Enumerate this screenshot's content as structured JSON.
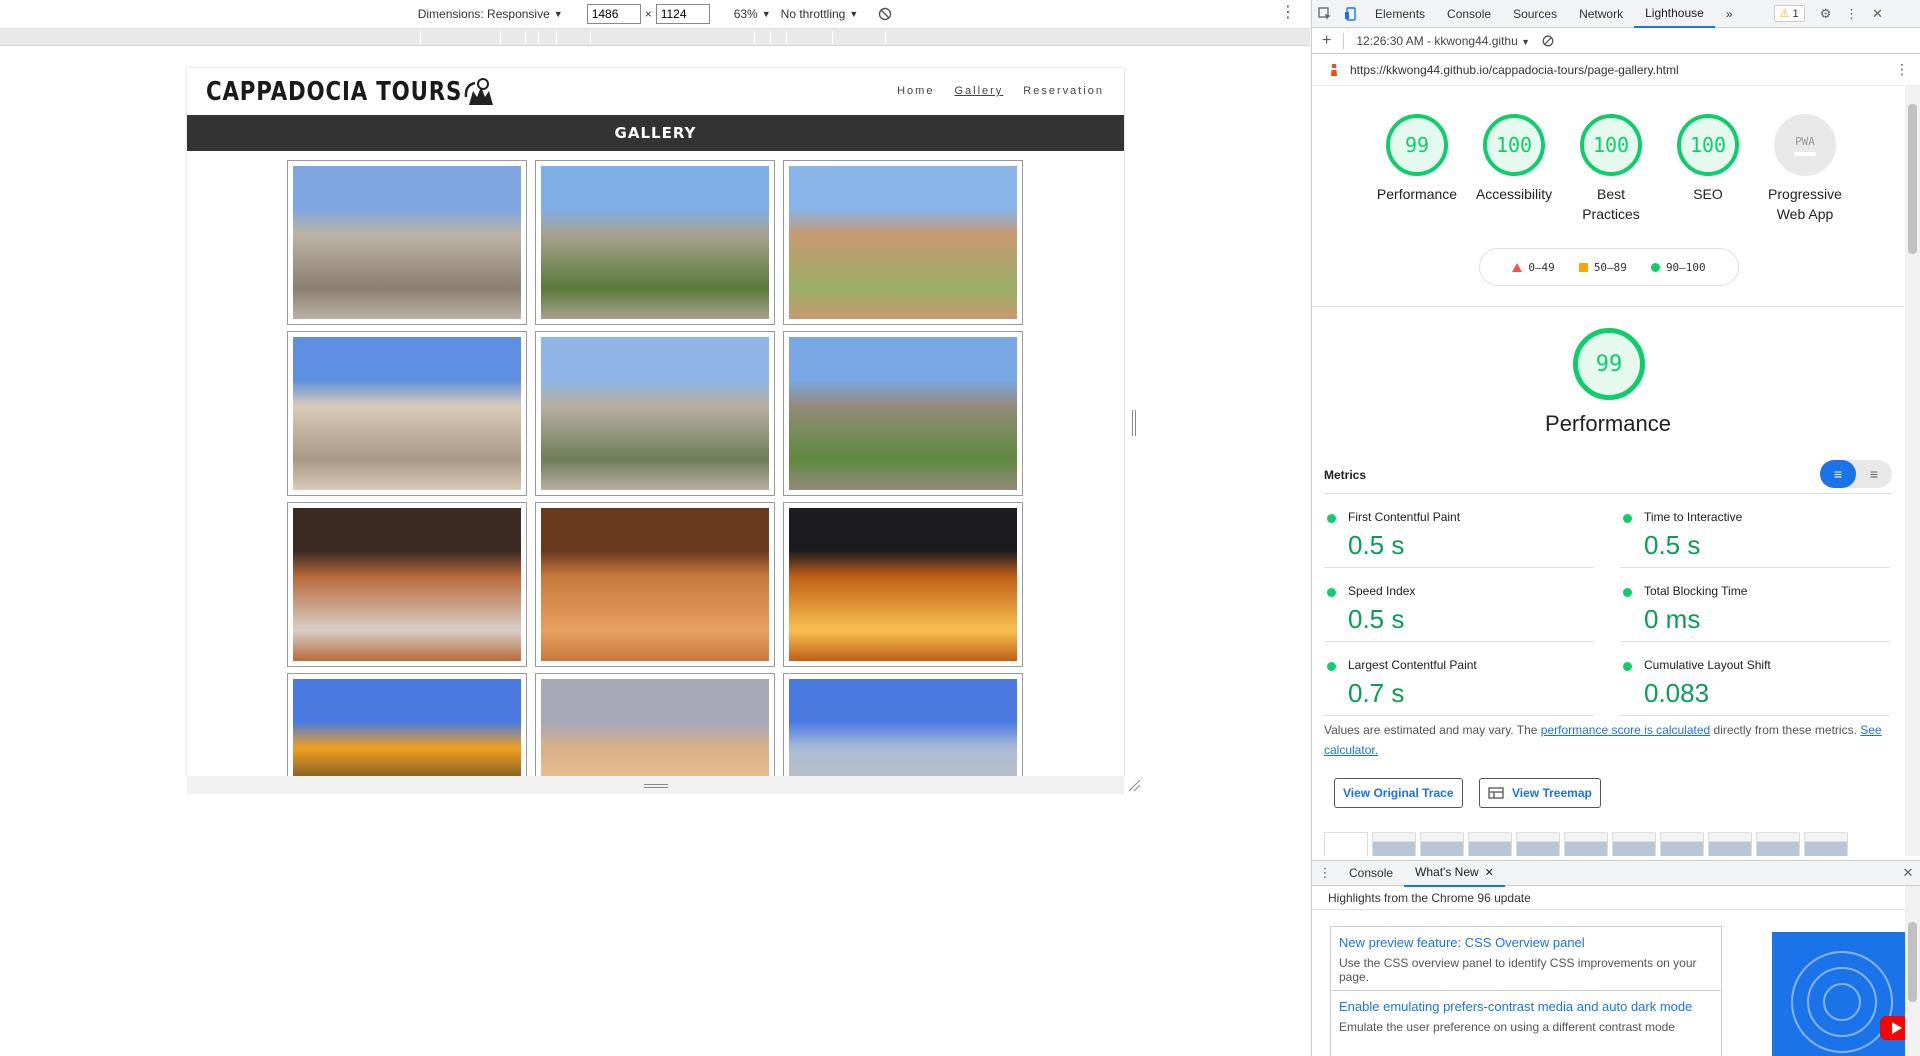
{
  "device_toolbar": {
    "dimensions_label": "Dimensions: Responsive",
    "width": "1486",
    "times": "×",
    "height": "1124",
    "zoom": "63%",
    "throttling": "No throttling"
  },
  "site": {
    "title": "CAPPADOCIA TOURS",
    "nav": [
      "Home",
      "Gallery",
      "Reservation"
    ],
    "active_nav": "Gallery",
    "section_heading": "GALLERY",
    "photos": [
      {
        "name": "rock-valley",
        "palette": [
          "#7fa6e0",
          "#bcb3a4",
          "#8b7f6e"
        ]
      },
      {
        "name": "fairy-chimneys",
        "palette": [
          "#7eaee6",
          "#a8a08e",
          "#5a7a3a"
        ]
      },
      {
        "name": "camel-rock",
        "palette": [
          "#88b4e8",
          "#c89a70",
          "#9ab068"
        ]
      },
      {
        "name": "cave-houses",
        "palette": [
          "#5f8fe0",
          "#d8cbb8",
          "#a89884"
        ]
      },
      {
        "name": "uchisar-castle",
        "palette": [
          "#8fb6e6",
          "#b8b0a0",
          "#6f7d5a"
        ]
      },
      {
        "name": "green-valley",
        "palette": [
          "#7aa8e4",
          "#948a7a",
          "#5e8a3e"
        ]
      },
      {
        "name": "underground-room",
        "palette": [
          "#3a2a20",
          "#b86a3a",
          "#d8d0c8"
        ]
      },
      {
        "name": "underground-tunnel",
        "palette": [
          "#6a3a1e",
          "#c8783e",
          "#e8a060"
        ]
      },
      {
        "name": "balloon-burner",
        "palette": [
          "#1c1c20",
          "#c06018",
          "#f8c050"
        ]
      },
      {
        "name": "balloon-check",
        "palette": [
          "#4a7ae0",
          "#f0a020",
          "#303030"
        ]
      },
      {
        "name": "balloon-sunrise",
        "palette": [
          "#a8a8b8",
          "#d8b088",
          "#f0c890"
        ]
      },
      {
        "name": "balloon-valley",
        "palette": [
          "#4a7ae0",
          "#aabbd8",
          "#c8c0b8"
        ]
      }
    ]
  },
  "devtools": {
    "tabs": [
      "Elements",
      "Console",
      "Sources",
      "Network",
      "Lighthouse"
    ],
    "active_tab": "Lighthouse",
    "more_tabs": "»",
    "warning_count": "1",
    "report_select": "12:26:30 AM - kkwong44.githu",
    "url": "https://kkwong44.github.io/cappadocia-tours/page-gallery.html",
    "scores": [
      {
        "value": "99",
        "label": "Performance"
      },
      {
        "value": "100",
        "label": "Accessibility"
      },
      {
        "value": "100",
        "label": "Best Practices"
      },
      {
        "value": "100",
        "label": "SEO"
      }
    ],
    "pwa": {
      "badge": "PWA",
      "label": "Progressive Web App"
    },
    "legend": [
      "0–49",
      "50–89",
      "90–100"
    ],
    "performance": {
      "score": "99",
      "title": "Performance",
      "metrics_title": "Metrics",
      "metrics": [
        {
          "label": "First Contentful Paint",
          "value": "0.5 s"
        },
        {
          "label": "Time to Interactive",
          "value": "0.5 s"
        },
        {
          "label": "Speed Index",
          "value": "0.5 s"
        },
        {
          "label": "Total Blocking Time",
          "value": "0 ms"
        },
        {
          "label": "Largest Contentful Paint",
          "value": "0.7 s"
        },
        {
          "label": "Cumulative Layout Shift",
          "value": "0.083"
        }
      ],
      "note_prefix": "Values are estimated and may vary. The ",
      "note_link": "performance score is calculated",
      "note_mid": " directly from these metrics. ",
      "note_link2": "See calculator.",
      "btn_trace": "View Original Trace",
      "btn_treemap": "View Treemap"
    },
    "drawer": {
      "tabs": [
        "Console",
        "What's New"
      ],
      "active_tab": "What's New",
      "heading": "Highlights from the Chrome 96 update",
      "cards": [
        {
          "title": "New preview feature: CSS Overview panel",
          "desc": "Use the CSS overview panel to identify CSS improvements on your page."
        },
        {
          "title": "Enable emulating prefers-contrast media and auto dark mode",
          "desc": "Emulate the user preference on using a different contrast mode"
        }
      ]
    }
  },
  "colors": {
    "pass": "#0cce6b",
    "link": "#1a73e8",
    "gallery_bar": "#333333"
  }
}
